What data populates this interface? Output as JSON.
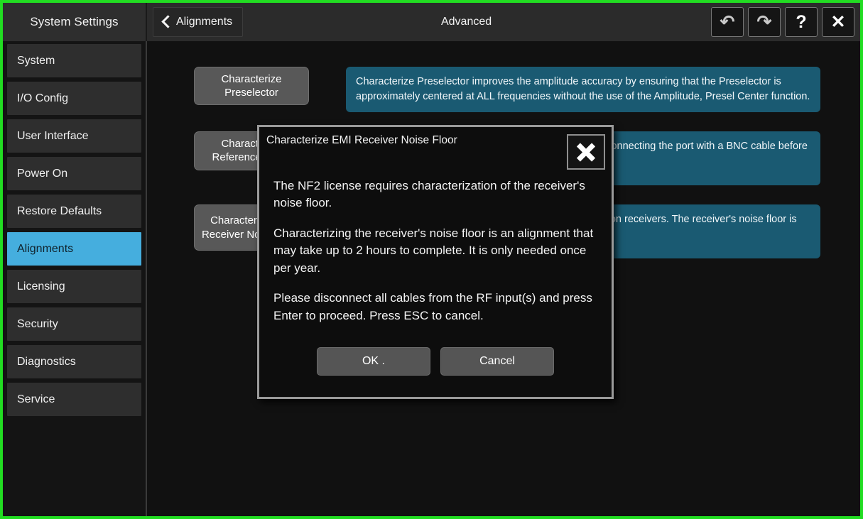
{
  "window": {
    "accent_border_color": "#22dd22",
    "background_color": "#111111"
  },
  "topbar": {
    "system_settings_label": "System Settings",
    "back_button_label": "Alignments",
    "page_title": "Advanced",
    "icons": [
      {
        "name": "undo-icon",
        "glyph": "↶"
      },
      {
        "name": "redo-icon",
        "glyph": "↷"
      },
      {
        "name": "help-icon",
        "glyph": "?"
      },
      {
        "name": "close-icon",
        "glyph": "✕"
      }
    ]
  },
  "sidebar": {
    "active_item": "Alignments",
    "highlight_color": "#45aede",
    "items": [
      {
        "label": "System",
        "active": false
      },
      {
        "label": "I/O Config",
        "active": false
      },
      {
        "label": "User Interface",
        "active": false
      },
      {
        "label": "Power On",
        "active": false
      },
      {
        "label": "Restore Defaults",
        "active": false
      },
      {
        "label": "Alignments",
        "active": true
      },
      {
        "label": "Licensing",
        "active": false
      },
      {
        "label": "Security",
        "active": false
      },
      {
        "label": "Diagnostics",
        "active": false
      },
      {
        "label": "Service",
        "active": false
      }
    ]
  },
  "main": {
    "info_panel_color": "#1a5a72",
    "rows": [
      {
        "button_label": "Characterize Preselector",
        "info_text": "Characterize Preselector improves the amplitude accuracy by ensuring that the Preselector is approximately centered at ALL frequencies without the use of the Amplitude, Presel Center function."
      },
      {
        "button_label": "Characterize Reference Clock",
        "info_text": "Characterize the External Reference Output. Requires connecting the port with a BNC cable before running"
      },
      {
        "button_label": "Characterize EMI Receiver Noise Floor",
        "info_text": "Characterize the Noise Floor Extensions. Only appears on receivers. The receiver's noise floor is an alignment that is only needed once per year."
      }
    ]
  },
  "dialog": {
    "title": "Characterize EMI Receiver Noise Floor",
    "close_icon": "close-icon",
    "paragraphs": [
      "The NF2 license requires characterization of the receiver's noise floor.",
      "Characterizing the receiver's noise floor is an alignment that may take up to 2 hours to complete. It is only needed once per year.",
      "Please disconnect all cables from the RF input(s) and press Enter to proceed. Press ESC to cancel."
    ],
    "ok_label": "OK .",
    "cancel_label": "Cancel"
  }
}
